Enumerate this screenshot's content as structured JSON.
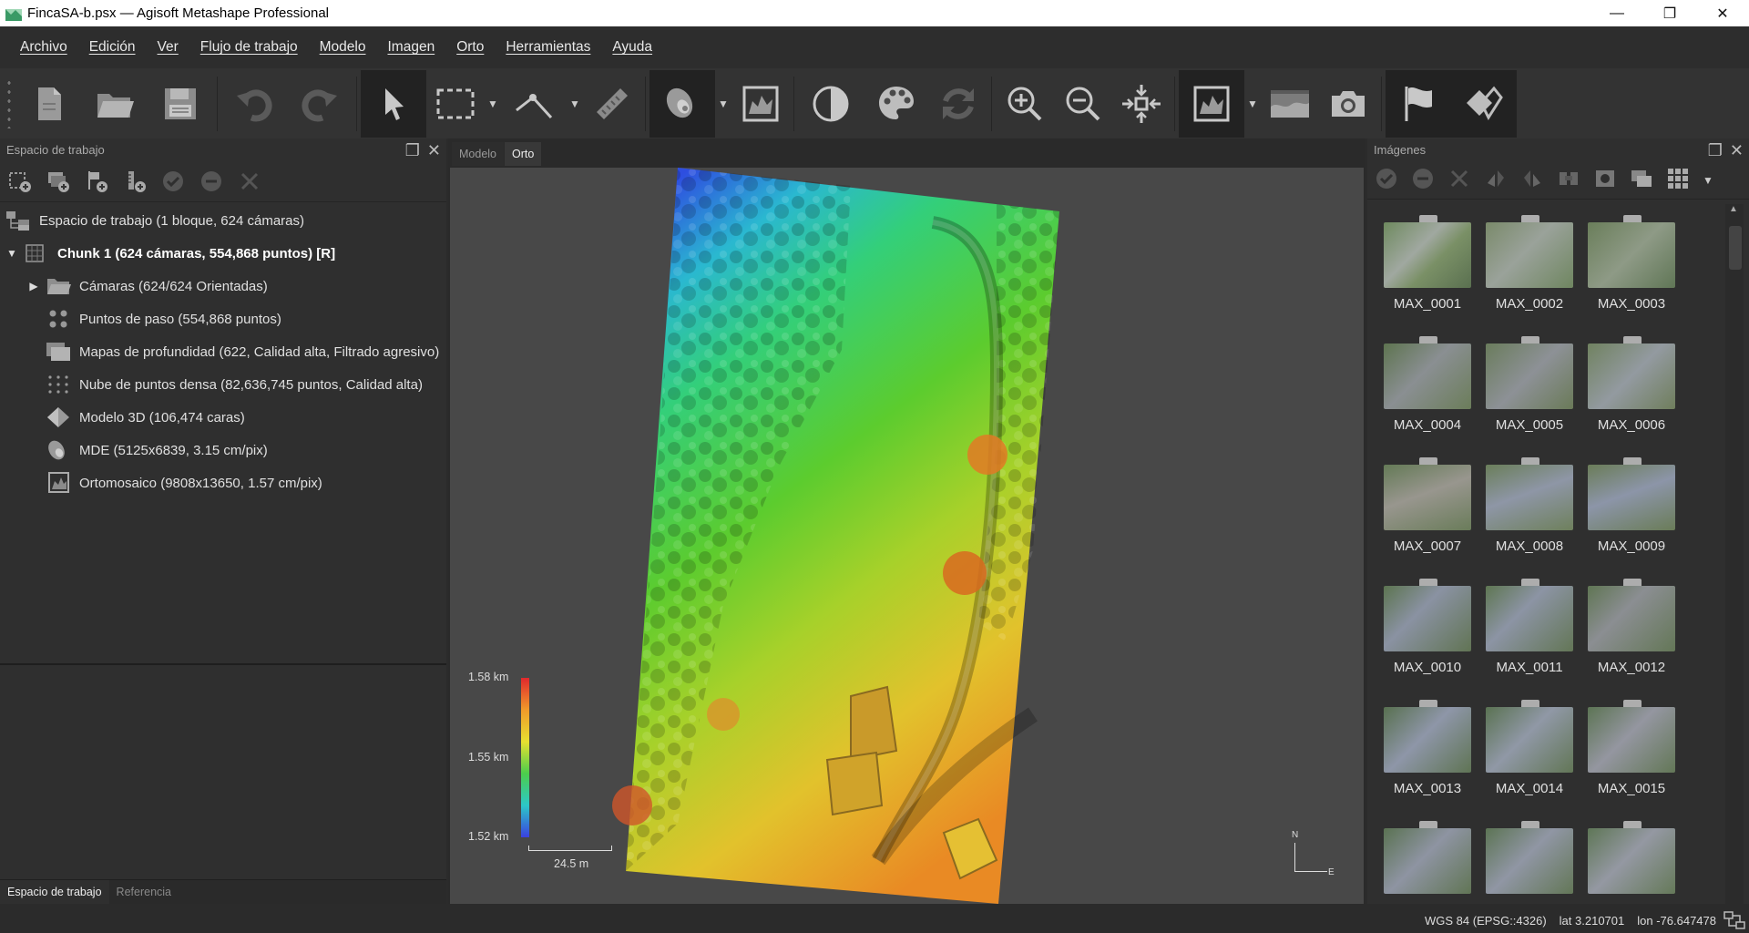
{
  "window": {
    "title": "FincaSA-b.psx — Agisoft Metashape Professional",
    "minimize": "—",
    "restore": "❐",
    "close": "✕"
  },
  "menu": [
    "Archivo",
    "Edición",
    "Ver",
    "Flujo de trabajo",
    "Modelo",
    "Imagen",
    "Orto",
    "Herramientas",
    "Ayuda"
  ],
  "toolbar": {
    "icons": [
      "new-document-icon",
      "open-folder-icon",
      "save-icon",
      "undo-icon",
      "redo-icon",
      "navigation-arrow-icon",
      "rectangle-selection-icon",
      "ruler-line-icon",
      "ruler-icon",
      "dem-icon",
      "orthomosaic-icon",
      "contrast-icon",
      "palette-icon",
      "refresh-icon",
      "zoom-in-icon",
      "zoom-out-icon",
      "fit-view-icon",
      "ortho-view-icon",
      "images-strip-icon",
      "camera-icon",
      "flag-icon",
      "shape-icon"
    ]
  },
  "left_panel": {
    "title": "Espacio de trabajo",
    "tree": [
      {
        "label": "Espacio de trabajo (1 bloque, 624 cámaras)",
        "icon": "workspace-icon",
        "bold": false
      },
      {
        "label": "Chunk 1 (624 cámaras, 554,868 puntos) [R]",
        "icon": "chunk-icon",
        "bold": true
      },
      {
        "label": "Cámaras (624/624 Orientadas)",
        "icon": "folder-icon",
        "bold": false
      },
      {
        "label": "Puntos de paso (554,868 puntos)",
        "icon": "tie-points-icon",
        "bold": false
      },
      {
        "label": "Mapas de profundidad (622, Calidad alta, Filtrado agresivo)",
        "icon": "depth-maps-icon",
        "bold": false
      },
      {
        "label": "Nube de puntos densa (82,636,745 puntos, Calidad alta)",
        "icon": "dense-cloud-icon",
        "bold": false
      },
      {
        "label": "Modelo 3D (106,474 caras)",
        "icon": "model-3d-icon",
        "bold": false
      },
      {
        "label": "MDE (5125x6839, 3.15 cm/pix)",
        "icon": "dem-icon",
        "bold": false
      },
      {
        "label": "Ortomosaico (9808x13650, 1.57 cm/pix)",
        "icon": "orthomosaic-icon",
        "bold": false
      }
    ],
    "tabs": [
      "Espacio de trabajo",
      "Referencia"
    ]
  },
  "viewport": {
    "tabs": [
      "Modelo",
      "Orto"
    ],
    "legend": {
      "max": "1.58 km",
      "mid": "1.55 km",
      "min": "1.52 km"
    },
    "scale": "24.5 m",
    "compass_n": "N",
    "compass_e": "E"
  },
  "right_panel": {
    "title": "Imágenes",
    "thumbnails": [
      "MAX_0001",
      "MAX_0002",
      "MAX_0003",
      "MAX_0004",
      "MAX_0005",
      "MAX_0006",
      "MAX_0007",
      "MAX_0008",
      "MAX_0009",
      "MAX_0010",
      "MAX_0011",
      "MAX_0012",
      "MAX_0013",
      "MAX_0014",
      "MAX_0015",
      "",
      "",
      ""
    ]
  },
  "status": {
    "crs": "WGS 84 (EPSG::4326)",
    "lat": "lat 3.210701",
    "lon": "lon -76.647478"
  }
}
